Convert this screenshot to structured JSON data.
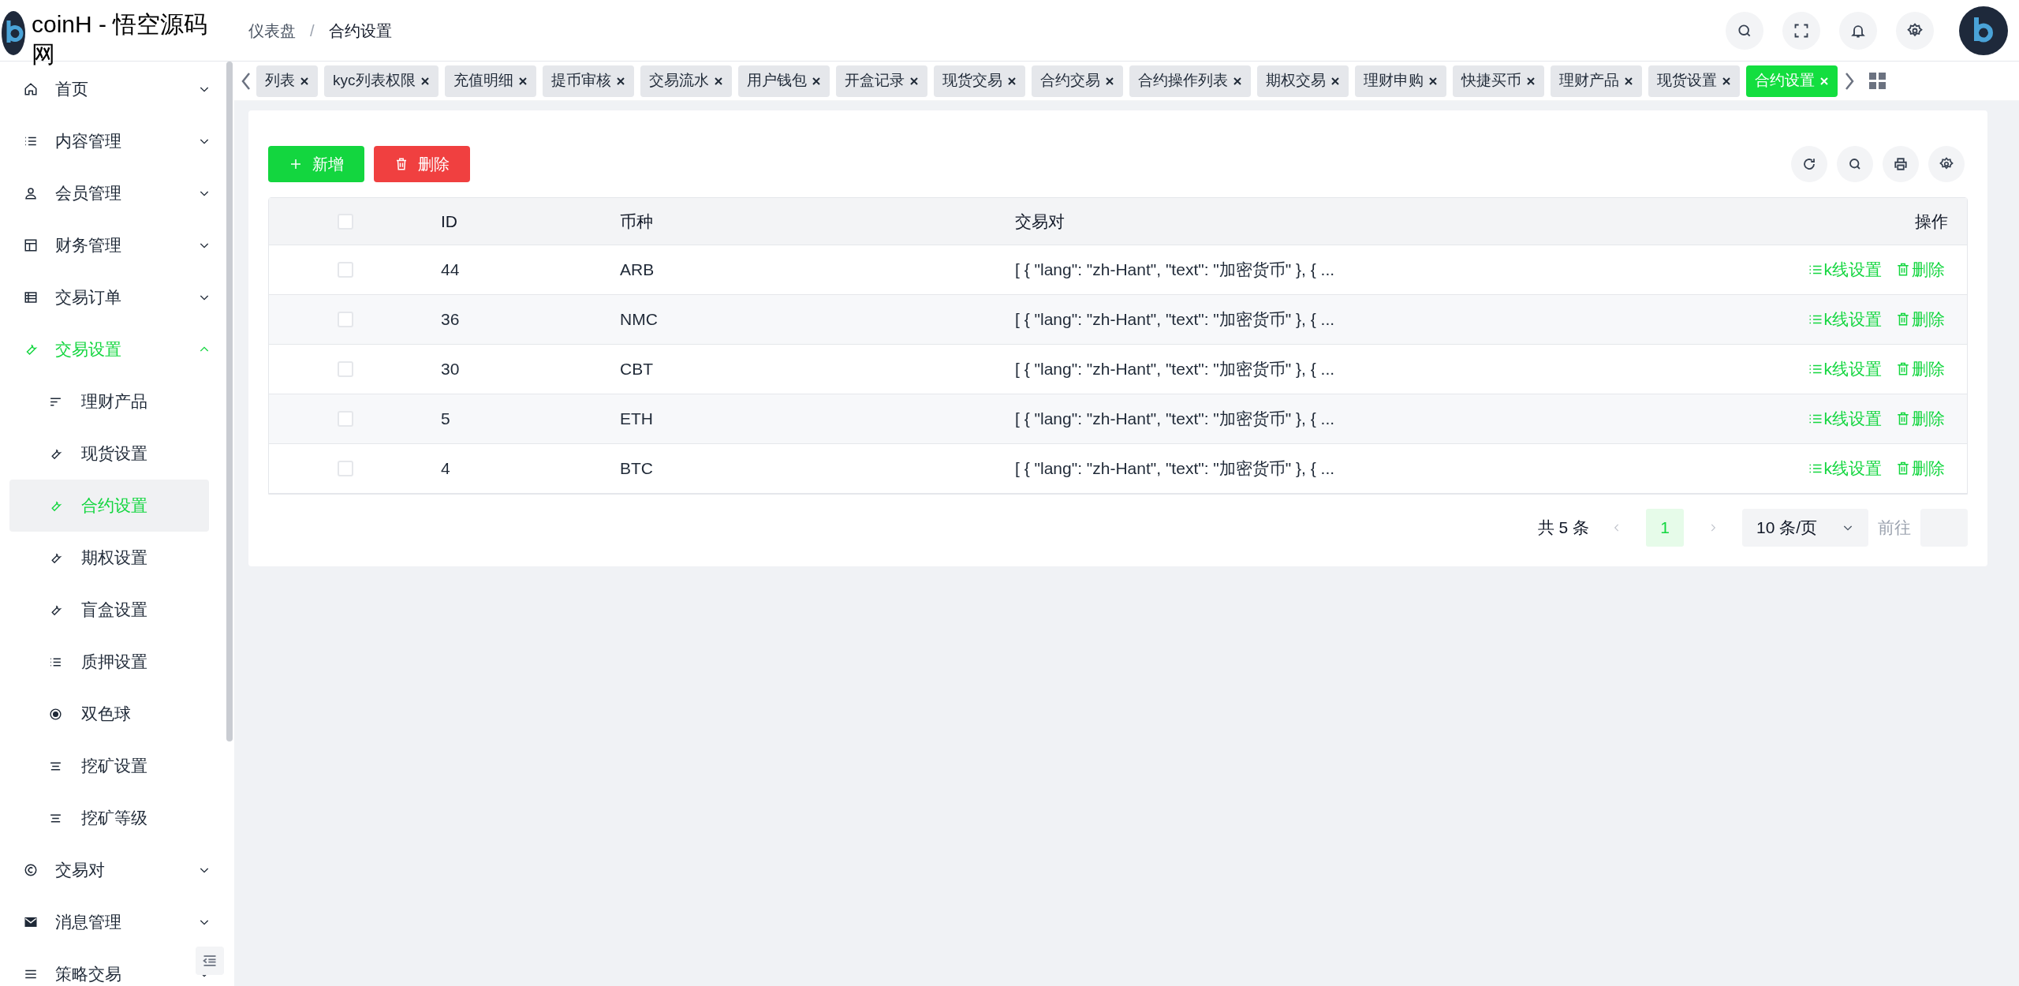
{
  "header": {
    "site_title": "coinH - 悟空源码网",
    "breadcrumb": [
      "仪表盘",
      "合约设置"
    ],
    "breadcrumb_separator": "/"
  },
  "tabs": [
    {
      "label": "列表",
      "selected": false
    },
    {
      "label": "kyc列表权限",
      "selected": false
    },
    {
      "label": "充值明细",
      "selected": false
    },
    {
      "label": "提币审核",
      "selected": false
    },
    {
      "label": "交易流水",
      "selected": false
    },
    {
      "label": "用户钱包",
      "selected": false
    },
    {
      "label": "开盒记录",
      "selected": false
    },
    {
      "label": "现货交易",
      "selected": false
    },
    {
      "label": "合约交易",
      "selected": false
    },
    {
      "label": "合约操作列表",
      "selected": false
    },
    {
      "label": "期权交易",
      "selected": false
    },
    {
      "label": "理财申购",
      "selected": false
    },
    {
      "label": "快捷买币",
      "selected": false
    },
    {
      "label": "理财产品",
      "selected": false
    },
    {
      "label": "现货设置",
      "selected": false
    },
    {
      "label": "合约设置",
      "selected": true
    }
  ],
  "sidebar": {
    "items": [
      {
        "label": "首页",
        "expanded": false
      },
      {
        "label": "内容管理",
        "expanded": false
      },
      {
        "label": "会员管理",
        "expanded": false
      },
      {
        "label": "财务管理",
        "expanded": false
      },
      {
        "label": "交易订单",
        "expanded": false
      },
      {
        "label": "交易设置",
        "expanded": true,
        "children": [
          {
            "label": "理财产品",
            "selected": false
          },
          {
            "label": "现货设置",
            "selected": false
          },
          {
            "label": "合约设置",
            "selected": true
          },
          {
            "label": "期权设置",
            "selected": false
          },
          {
            "label": "盲盒设置",
            "selected": false
          },
          {
            "label": "质押设置",
            "selected": false
          },
          {
            "label": "双色球",
            "selected": false
          },
          {
            "label": "挖矿设置",
            "selected": false
          },
          {
            "label": "挖矿等级",
            "selected": false
          }
        ]
      },
      {
        "label": "交易对",
        "expanded": false
      },
      {
        "label": "消息管理",
        "expanded": false
      },
      {
        "label": "策略交易",
        "expanded": false
      }
    ]
  },
  "toolbar": {
    "buttons": [
      {
        "label": "新增",
        "kind": "add"
      },
      {
        "label": "删除",
        "kind": "delete"
      }
    ]
  },
  "table": {
    "header_checked": false,
    "columns": [
      "ID",
      "币种",
      "交易对",
      "操作"
    ],
    "rows": [
      {
        "checked": false,
        "id": "44",
        "coin": "ARB",
        "pairs": "[ { \"lang\": \"zh-Hant\", \"text\": \"加密货币\" }, { ...",
        "actions": [
          "k线设置",
          "删除"
        ]
      },
      {
        "checked": false,
        "id": "36",
        "coin": "NMC",
        "pairs": "[ { \"lang\": \"zh-Hant\", \"text\": \"加密货币\" }, { ...",
        "actions": [
          "k线设置",
          "删除"
        ]
      },
      {
        "checked": false,
        "id": "30",
        "coin": "CBT",
        "pairs": "[ { \"lang\": \"zh-Hant\", \"text\": \"加密货币\" }, { ...",
        "actions": [
          "k线设置",
          "删除"
        ]
      },
      {
        "checked": false,
        "id": "5",
        "coin": "ETH",
        "pairs": "[ { \"lang\": \"zh-Hant\", \"text\": \"加密货币\" }, { ...",
        "actions": [
          "k线设置",
          "删除"
        ]
      },
      {
        "checked": false,
        "id": "4",
        "coin": "BTC",
        "pairs": "[ { \"lang\": \"zh-Hant\", \"text\": \"加密货币\" }, { ...",
        "actions": [
          "k线设置",
          "删除"
        ]
      }
    ]
  },
  "pagination": {
    "total": "共 5 条",
    "pages": [
      {
        "label": "1",
        "selected": true
      }
    ],
    "page_size": "10 条/页",
    "goto_label": "前往"
  }
}
